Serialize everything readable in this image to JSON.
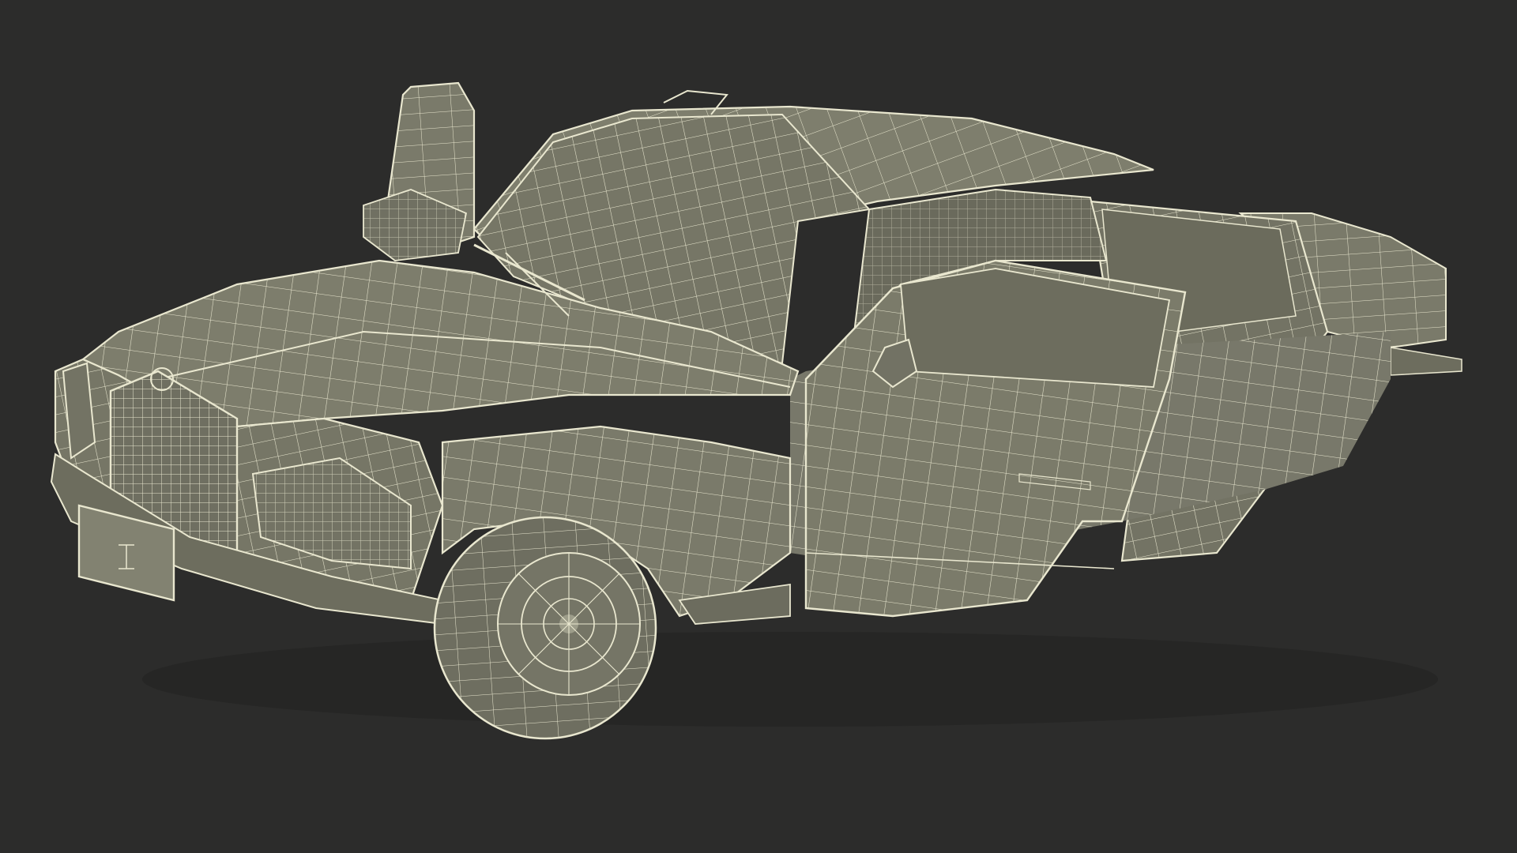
{
  "scene": {
    "subject": "wireframe-sedan",
    "background_color": "#2c2c2b",
    "surface_color": "#7a7a6a",
    "surface_shadow_color": "#5c5d50",
    "surface_light_color": "#8c8b79",
    "wire_color": "#e9e7cf",
    "wire_dim_color": "#cfccb2"
  }
}
